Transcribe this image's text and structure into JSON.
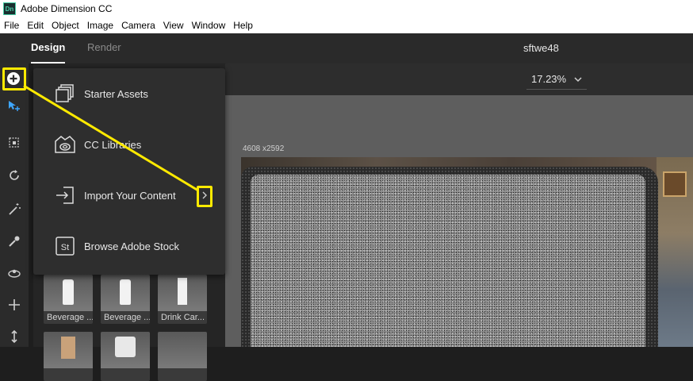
{
  "titlebar": {
    "app_icon_text": "Dn",
    "title": "Adobe Dimension CC"
  },
  "menu": [
    "File",
    "Edit",
    "Object",
    "Image",
    "Camera",
    "View",
    "Window",
    "Help"
  ],
  "tabs": {
    "design": "Design",
    "render": "Render"
  },
  "document_title": "sftwe48",
  "zoom": {
    "value": "17.23%"
  },
  "canvas": {
    "size_label": "4608 x2592"
  },
  "add_menu": {
    "items": [
      {
        "label": "Starter Assets",
        "icon": "starter-assets-icon"
      },
      {
        "label": "CC Libraries",
        "icon": "cc-libraries-icon"
      },
      {
        "label": "Import Your Content",
        "icon": "import-icon",
        "has_submenu": true
      },
      {
        "label": "Browse Adobe Stock",
        "icon": "adobe-stock-icon",
        "icon_text": "St"
      }
    ]
  },
  "assets": [
    {
      "label": "Beverage ..."
    },
    {
      "label": "Beverage ..."
    },
    {
      "label": "Drink Car..."
    }
  ],
  "tools": [
    "add-icon",
    "select-icon",
    "transform-icon",
    "rotate-icon",
    "magic-wand-icon",
    "eyedropper-icon",
    "orbit-icon",
    "pan-icon",
    "dolly-icon"
  ],
  "colors": {
    "highlight": "#ffea00",
    "panel": "#2e2e2e",
    "background": "#1e1e1e"
  }
}
